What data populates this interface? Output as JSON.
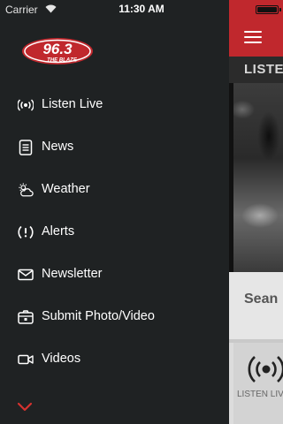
{
  "status_bar": {
    "carrier": "Carrier",
    "time": "11:30 AM"
  },
  "brand": {
    "logo_number": "96.3",
    "logo_tagline": "THE BLAZE",
    "accent_color": "#c0282d"
  },
  "drawer": {
    "items": [
      {
        "label": "Listen Live",
        "icon": "radio-broadcast-icon"
      },
      {
        "label": "News",
        "icon": "news-document-icon"
      },
      {
        "label": "Weather",
        "icon": "weather-sun-cloud-icon"
      },
      {
        "label": "Alerts",
        "icon": "alert-exclamation-icon"
      },
      {
        "label": "Newsletter",
        "icon": "envelope-icon"
      },
      {
        "label": "Submit Photo/Video",
        "icon": "camera-icon"
      },
      {
        "label": "Videos",
        "icon": "video-camera-icon"
      }
    ],
    "more_icon": "chevron-down-icon"
  },
  "main": {
    "section_title": "LISTEN",
    "host_name": "Sean",
    "live_button_label": "LISTEN LIVE"
  }
}
